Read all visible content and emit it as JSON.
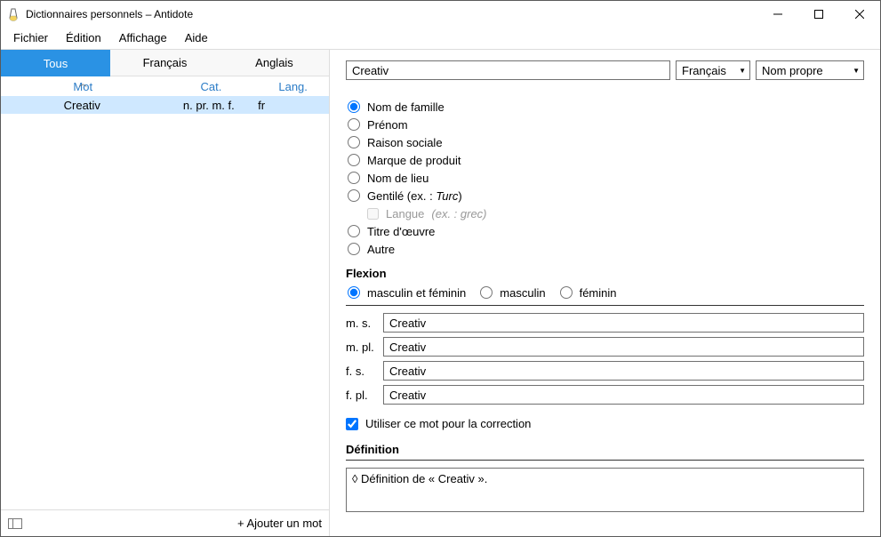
{
  "window": {
    "title": "Dictionnaires personnels – Antidote"
  },
  "menubar": [
    "Fichier",
    "Édition",
    "Affichage",
    "Aide"
  ],
  "left": {
    "tabs": [
      "Tous",
      "Français",
      "Anglais"
    ],
    "active_tab": 0,
    "columns": {
      "mot": "Mot",
      "cat": "Cat.",
      "lang": "Lang."
    },
    "rows": [
      {
        "mot": "Creativ",
        "cat": "n. pr. m. f.",
        "lang": "fr"
      }
    ],
    "footer": {
      "add": "+ Ajouter un mot"
    }
  },
  "right": {
    "word_input": "Creativ",
    "lang_combo": "Français",
    "type_combo": "Nom propre",
    "radios": [
      {
        "label": "Nom de famille",
        "checked": true
      },
      {
        "label": "Prénom",
        "checked": false
      },
      {
        "label": "Raison sociale",
        "checked": false
      },
      {
        "label": "Marque de produit",
        "checked": false
      },
      {
        "label": "Nom de lieu",
        "checked": false
      },
      {
        "label_html": "Gentilé (ex. : <em>Turc</em>)",
        "checked": false,
        "sub": {
          "label": "Langue",
          "ex": "(ex. : grec)"
        }
      },
      {
        "label": "Titre d'œuvre",
        "checked": false
      },
      {
        "label": "Autre",
        "checked": false
      }
    ],
    "flexion": {
      "title": "Flexion",
      "options": [
        "masculin et féminin",
        "masculin",
        "féminin"
      ],
      "selected": 0,
      "forms": [
        {
          "label": "m. s.",
          "value": "Creativ"
        },
        {
          "label": "m. pl.",
          "value": "Creativ"
        },
        {
          "label": "f. s.",
          "value": "Creativ"
        },
        {
          "label": "f. pl.",
          "value": "Creativ"
        }
      ]
    },
    "correction_check": {
      "label": "Utiliser ce mot pour la correction",
      "checked": true
    },
    "definition": {
      "title": "Définition",
      "text": "◊ Définition de « Creativ »."
    }
  }
}
